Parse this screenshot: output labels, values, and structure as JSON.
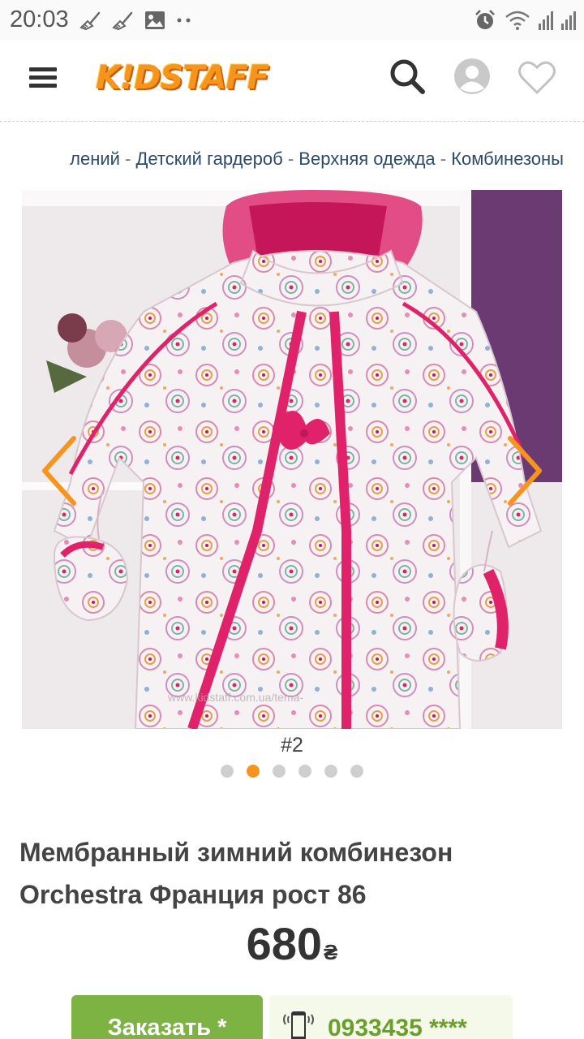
{
  "status_bar": {
    "time": "20:03",
    "left_icons": [
      "broom-icon",
      "broom-icon",
      "image-icon",
      "more-dots-icon"
    ],
    "right_icons": [
      "alarm-icon",
      "wifi-icon",
      "signal-icon",
      "signal-icon"
    ]
  },
  "header": {
    "logo_text": "K!DSTAFF",
    "icons": [
      "menu-icon",
      "search-icon",
      "user-icon",
      "heart-icon"
    ]
  },
  "breadcrumb": {
    "items": [
      "лений",
      "Детский гардероб",
      "Верхняя одежда",
      "Комбинезоны"
    ],
    "separator": "-"
  },
  "gallery": {
    "counter": "#2",
    "dot_count": 6,
    "active_index": 1,
    "watermark": "www.kidstaff.com.ua/tema-"
  },
  "product": {
    "title": "Мембранный зимний комбинезон Orchestra Франция рост 86",
    "price": "680",
    "currency": "₴"
  },
  "actions": {
    "order_label": "Заказать *",
    "phone": "0933435 ****"
  },
  "colors": {
    "accent_orange": "#f7941d",
    "green": "#7cb342",
    "pink": "#e0226a"
  }
}
